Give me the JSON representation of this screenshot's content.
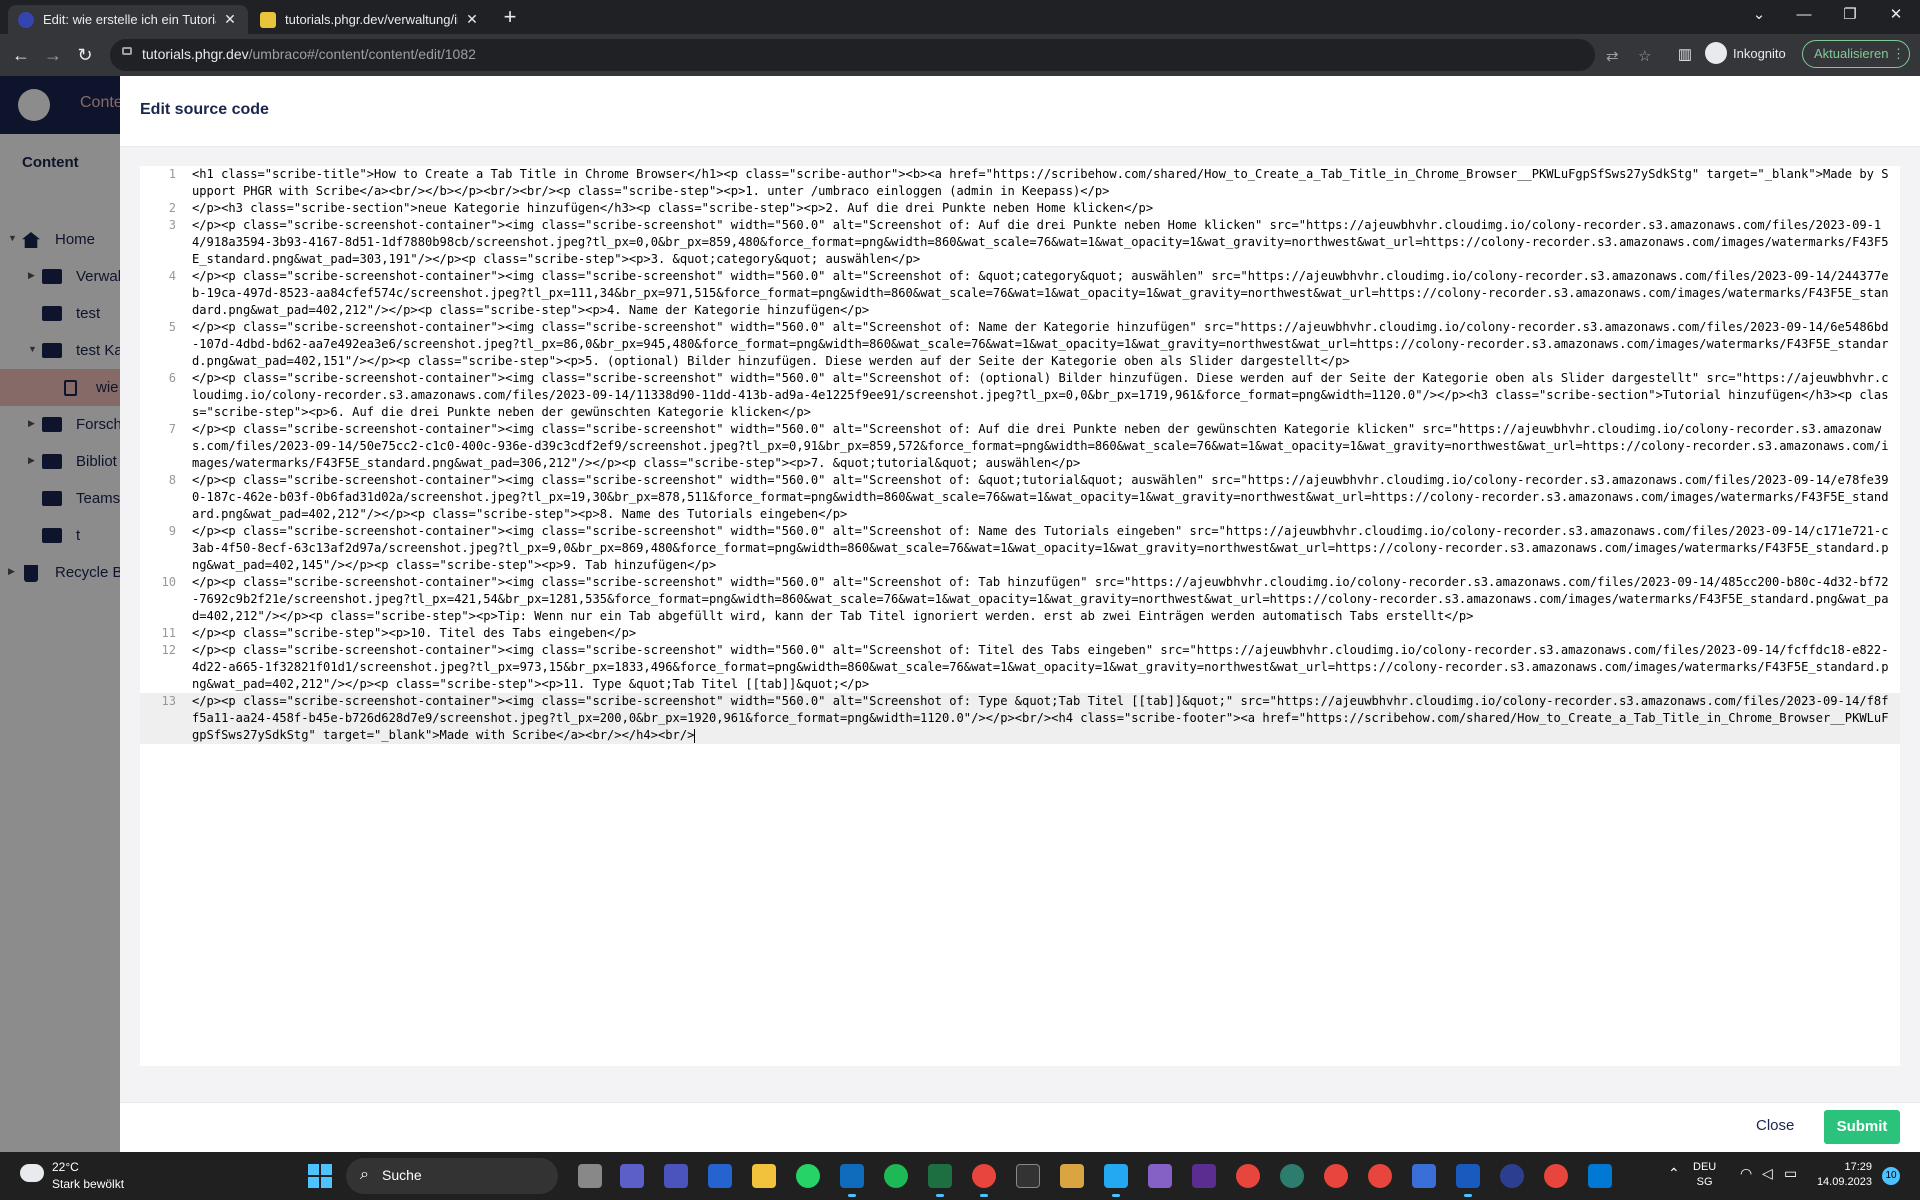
{
  "browser": {
    "tabs": [
      {
        "title": "Edit: wie erstelle ich ein Tutorial",
        "active": true
      },
      {
        "title": "tutorials.phgr.dev/verwaltung/inf",
        "active": false
      }
    ],
    "url_host": "tutorials.phgr.dev",
    "url_path": "/umbraco#/content/content/edit/1082",
    "profile_label": "Inkognito",
    "update_label": "Aktualisieren"
  },
  "umbraco": {
    "section_tab": "Conte",
    "tree_title": "Content",
    "tree": [
      {
        "label": "Home"
      },
      {
        "label": "Verwal"
      },
      {
        "label": "test"
      },
      {
        "label": "test Ka"
      },
      {
        "label": "wie"
      },
      {
        "label": "Forsch"
      },
      {
        "label": "Bibliot"
      },
      {
        "label": "Teams"
      },
      {
        "label": "t"
      },
      {
        "label": "Recycle Bi"
      }
    ]
  },
  "dialog": {
    "title": "Edit source code",
    "close_label": "Close",
    "submit_label": "Submit",
    "lines": [
      {
        "num": "1",
        "text": "<h1 class=\"scribe-title\">How to Create a Tab Title in Chrome Browser</h1><p class=\"scribe-author\"><b><a href=\"https://scribehow.com/shared/How_to_Create_a_Tab_Title_in_Chrome_Browser__PKWLuFgpSfSws27ySdkStg\" target=\"_blank\">Made by Support PHGR with Scribe</a><br/></b></p><br/><br/><p class=\"scribe-step\"><p>1. unter /umbraco einloggen (admin in Keepass)</p>"
      },
      {
        "num": "2",
        "text": "</p><h3 class=\"scribe-section\">neue Kategorie hinzufügen</h3><p class=\"scribe-step\"><p>2. Auf die drei Punkte neben Home klicken</p>"
      },
      {
        "num": "3",
        "text": "</p><p class=\"scribe-screenshot-container\"><img class=\"scribe-screenshot\" width=\"560.0\" alt=\"Screenshot of: Auf die drei Punkte neben Home klicken\" src=\"https://ajeuwbhvhr.cloudimg.io/colony-recorder.s3.amazonaws.com/files/2023-09-14/918a3594-3b93-4167-8d51-1df7880b98cb/screenshot.jpeg?tl_px=0,0&br_px=859,480&force_format=png&width=860&wat_scale=76&wat=1&wat_opacity=1&wat_gravity=northwest&wat_url=https://colony-recorder.s3.amazonaws.com/images/watermarks/F43F5E_standard.png&wat_pad=303,191\"/></p><p class=\"scribe-step\"><p>3. &quot;category&quot; auswählen</p>"
      },
      {
        "num": "4",
        "text": "</p><p class=\"scribe-screenshot-container\"><img class=\"scribe-screenshot\" width=\"560.0\" alt=\"Screenshot of: &quot;category&quot; auswählen\" src=\"https://ajeuwbhvhr.cloudimg.io/colony-recorder.s3.amazonaws.com/files/2023-09-14/244377eb-19ca-497d-8523-aa84cfef574c/screenshot.jpeg?tl_px=111,34&br_px=971,515&force_format=png&width=860&wat_scale=76&wat=1&wat_opacity=1&wat_gravity=northwest&wat_url=https://colony-recorder.s3.amazonaws.com/images/watermarks/F43F5E_standard.png&wat_pad=402,212\"/></p><p class=\"scribe-step\"><p>4. Name der Kategorie hinzufügen</p>"
      },
      {
        "num": "5",
        "text": "</p><p class=\"scribe-screenshot-container\"><img class=\"scribe-screenshot\" width=\"560.0\" alt=\"Screenshot of: Name der Kategorie hinzufügen\" src=\"https://ajeuwbhvhr.cloudimg.io/colony-recorder.s3.amazonaws.com/files/2023-09-14/6e5486bd-107d-4dbd-bd62-aa7e492ea3e6/screenshot.jpeg?tl_px=86,0&br_px=945,480&force_format=png&width=860&wat_scale=76&wat=1&wat_opacity=1&wat_gravity=northwest&wat_url=https://colony-recorder.s3.amazonaws.com/images/watermarks/F43F5E_standard.png&wat_pad=402,151\"/></p><p class=\"scribe-step\"><p>5. (optional) Bilder hinzufügen. Diese werden auf der Seite der Kategorie oben als Slider dargestellt</p>"
      },
      {
        "num": "6",
        "text": "</p><p class=\"scribe-screenshot-container\"><img class=\"scribe-screenshot\" width=\"560.0\" alt=\"Screenshot of: (optional) Bilder hinzufügen. Diese werden auf der Seite der Kategorie oben als Slider dargestellt\" src=\"https://ajeuwbhvhr.cloudimg.io/colony-recorder.s3.amazonaws.com/files/2023-09-14/11338d90-11dd-413b-ad9a-4e1225f9ee91/screenshot.jpeg?tl_px=0,0&br_px=1719,961&force_format=png&width=1120.0\"/></p><h3 class=\"scribe-section\">Tutorial hinzufügen</h3><p class=\"scribe-step\"><p>6. Auf die drei Punkte neben der gewünschten Kategorie klicken</p>"
      },
      {
        "num": "7",
        "text": "</p><p class=\"scribe-screenshot-container\"><img class=\"scribe-screenshot\" width=\"560.0\" alt=\"Screenshot of: Auf die drei Punkte neben der gewünschten Kategorie klicken\" src=\"https://ajeuwbhvhr.cloudimg.io/colony-recorder.s3.amazonaws.com/files/2023-09-14/50e75cc2-c1c0-400c-936e-d39c3cdf2ef9/screenshot.jpeg?tl_px=0,91&br_px=859,572&force_format=png&width=860&wat_scale=76&wat=1&wat_opacity=1&wat_gravity=northwest&wat_url=https://colony-recorder.s3.amazonaws.com/images/watermarks/F43F5E_standard.png&wat_pad=306,212\"/></p><p class=\"scribe-step\"><p>7. &quot;tutorial&quot; auswählen</p>"
      },
      {
        "num": "8",
        "text": "</p><p class=\"scribe-screenshot-container\"><img class=\"scribe-screenshot\" width=\"560.0\" alt=\"Screenshot of: &quot;tutorial&quot; auswählen\" src=\"https://ajeuwbhvhr.cloudimg.io/colony-recorder.s3.amazonaws.com/files/2023-09-14/e78fe390-187c-462e-b03f-0b6fad31d02a/screenshot.jpeg?tl_px=19,30&br_px=878,511&force_format=png&width=860&wat_scale=76&wat=1&wat_opacity=1&wat_gravity=northwest&wat_url=https://colony-recorder.s3.amazonaws.com/images/watermarks/F43F5E_standard.png&wat_pad=402,212\"/></p><p class=\"scribe-step\"><p>8. Name des Tutorials eingeben</p>"
      },
      {
        "num": "9",
        "text": "</p><p class=\"scribe-screenshot-container\"><img class=\"scribe-screenshot\" width=\"560.0\" alt=\"Screenshot of: Name des Tutorials eingeben\" src=\"https://ajeuwbhvhr.cloudimg.io/colony-recorder.s3.amazonaws.com/files/2023-09-14/c171e721-c3ab-4f50-8ecf-63c13af2d97a/screenshot.jpeg?tl_px=9,0&br_px=869,480&force_format=png&width=860&wat_scale=76&wat=1&wat_opacity=1&wat_gravity=northwest&wat_url=https://colony-recorder.s3.amazonaws.com/images/watermarks/F43F5E_standard.png&wat_pad=402,145\"/></p><p class=\"scribe-step\"><p>9. Tab hinzufügen</p>"
      },
      {
        "num": "10",
        "text": "</p><p class=\"scribe-screenshot-container\"><img class=\"scribe-screenshot\" width=\"560.0\" alt=\"Screenshot of: Tab hinzufügen\" src=\"https://ajeuwbhvhr.cloudimg.io/colony-recorder.s3.amazonaws.com/files/2023-09-14/485cc200-b80c-4d32-bf72-7692c9b2f21e/screenshot.jpeg?tl_px=421,54&br_px=1281,535&force_format=png&width=860&wat_scale=76&wat=1&wat_opacity=1&wat_gravity=northwest&wat_url=https://colony-recorder.s3.amazonaws.com/images/watermarks/F43F5E_standard.png&wat_pad=402,212\"/></p><p class=\"scribe-step\"><p>Tip: Wenn nur ein Tab abgefüllt wird, kann der Tab Titel ignoriert werden. erst ab zwei Einträgen werden automatisch Tabs erstellt</p>"
      },
      {
        "num": "11",
        "text": "</p><p class=\"scribe-step\"><p>10. Titel des Tabs eingeben</p>"
      },
      {
        "num": "12",
        "text": "</p><p class=\"scribe-screenshot-container\"><img class=\"scribe-screenshot\" width=\"560.0\" alt=\"Screenshot of: Titel des Tabs eingeben\" src=\"https://ajeuwbhvhr.cloudimg.io/colony-recorder.s3.amazonaws.com/files/2023-09-14/fcffdc18-e822-4d22-a665-1f32821f01d1/screenshot.jpeg?tl_px=973,15&br_px=1833,496&force_format=png&width=860&wat_scale=76&wat=1&wat_opacity=1&wat_gravity=northwest&wat_url=https://colony-recorder.s3.amazonaws.com/images/watermarks/F43F5E_standard.png&wat_pad=402,212\"/></p><p class=\"scribe-step\"><p>11. Type &quot;Tab Titel [[tab]]&quot;</p>"
      },
      {
        "num": "13",
        "text": "</p><p class=\"scribe-screenshot-container\"><img class=\"scribe-screenshot\" width=\"560.0\" alt=\"Screenshot of: Type &quot;Tab Titel [[tab]]&quot;\" src=\"https://ajeuwbhvhr.cloudimg.io/colony-recorder.s3.amazonaws.com/files/2023-09-14/f8ff5a11-aa24-458f-b45e-b726d628d7e9/screenshot.jpeg?tl_px=200,0&br_px=1920,961&force_format=png&width=1120.0\"/></p><br/><h4 class=\"scribe-footer\"><a href=\"https://scribehow.com/shared/How_to_Create_a_Tab_Title_in_Chrome_Browser__PKWLuFgpSfSws27ySdkStg\" target=\"_blank\">Made with Scribe</a><br/></h4><br/>"
      }
    ]
  },
  "taskbar": {
    "temperature": "22°C",
    "weather_text": "Stark bewölkt",
    "search_label": "Suche",
    "lang_line1": "DEU",
    "lang_line2": "SG",
    "time": "17:29",
    "date": "14.09.2023",
    "notification_count": "10"
  }
}
